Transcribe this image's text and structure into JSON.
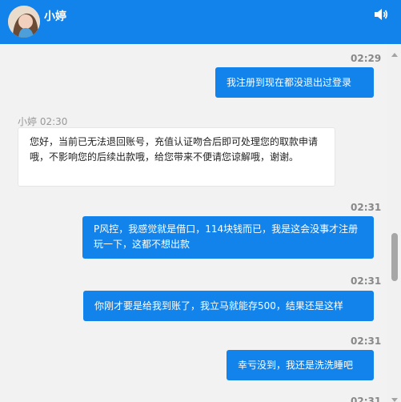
{
  "header": {
    "name": "小婷"
  },
  "messages": [
    {
      "side": "out",
      "time": "02:29",
      "text": "我注册到现在都没退出过登录"
    },
    {
      "side": "in",
      "sender": "小婷",
      "time": "02:30",
      "text": "您好，当前已无法退回账号，充值认证吻合后即可处理您的取款申请哦，不影响您的后续出款哦，给您带来不便请您谅解哦，谢谢。"
    },
    {
      "side": "out",
      "time": "02:31",
      "text": "P风控，我感觉就是借口，114块钱而已，我是这会没事才注册玩一下，这都不想出款"
    },
    {
      "side": "out",
      "time": "02:31",
      "text": "你刚才要是给我到账了，我立马就能存500，结果还是这样"
    },
    {
      "side": "out",
      "time": "02:31",
      "text": "幸亏没到，我还是洗洗睡吧"
    },
    {
      "side": "out",
      "time": "02:31"
    }
  ],
  "colors": {
    "accent": "#1283ea",
    "page_bg": "#f2f2f2"
  },
  "icons": {
    "header_action": "speaker-icon"
  }
}
